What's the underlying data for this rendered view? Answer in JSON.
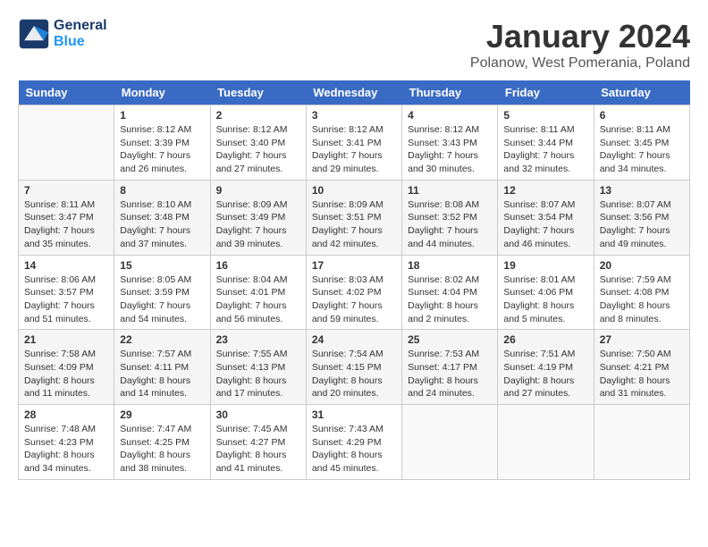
{
  "header": {
    "logo_line1": "General",
    "logo_line2": "Blue",
    "month_title": "January 2024",
    "location": "Polanow, West Pomerania, Poland"
  },
  "weekdays": [
    "Sunday",
    "Monday",
    "Tuesday",
    "Wednesday",
    "Thursday",
    "Friday",
    "Saturday"
  ],
  "weeks": [
    [
      {
        "day": "",
        "info": ""
      },
      {
        "day": "1",
        "info": "Sunrise: 8:12 AM\nSunset: 3:39 PM\nDaylight: 7 hours\nand 26 minutes."
      },
      {
        "day": "2",
        "info": "Sunrise: 8:12 AM\nSunset: 3:40 PM\nDaylight: 7 hours\nand 27 minutes."
      },
      {
        "day": "3",
        "info": "Sunrise: 8:12 AM\nSunset: 3:41 PM\nDaylight: 7 hours\nand 29 minutes."
      },
      {
        "day": "4",
        "info": "Sunrise: 8:12 AM\nSunset: 3:43 PM\nDaylight: 7 hours\nand 30 minutes."
      },
      {
        "day": "5",
        "info": "Sunrise: 8:11 AM\nSunset: 3:44 PM\nDaylight: 7 hours\nand 32 minutes."
      },
      {
        "day": "6",
        "info": "Sunrise: 8:11 AM\nSunset: 3:45 PM\nDaylight: 7 hours\nand 34 minutes."
      }
    ],
    [
      {
        "day": "7",
        "info": ""
      },
      {
        "day": "8",
        "info": "Sunrise: 8:10 AM\nSunset: 3:48 PM\nDaylight: 7 hours\nand 37 minutes."
      },
      {
        "day": "9",
        "info": "Sunrise: 8:09 AM\nSunset: 3:49 PM\nDaylight: 7 hours\nand 39 minutes."
      },
      {
        "day": "10",
        "info": "Sunrise: 8:09 AM\nSunset: 3:51 PM\nDaylight: 7 hours\nand 42 minutes."
      },
      {
        "day": "11",
        "info": "Sunrise: 8:08 AM\nSunset: 3:52 PM\nDaylight: 7 hours\nand 44 minutes."
      },
      {
        "day": "12",
        "info": "Sunrise: 8:07 AM\nSunset: 3:54 PM\nDaylight: 7 hours\nand 46 minutes."
      },
      {
        "day": "13",
        "info": "Sunrise: 8:07 AM\nSunset: 3:56 PM\nDaylight: 7 hours\nand 49 minutes."
      }
    ],
    [
      {
        "day": "14",
        "info": ""
      },
      {
        "day": "15",
        "info": "Sunrise: 8:05 AM\nSunset: 3:59 PM\nDaylight: 7 hours\nand 54 minutes."
      },
      {
        "day": "16",
        "info": "Sunrise: 8:04 AM\nSunset: 4:01 PM\nDaylight: 7 hours\nand 56 minutes."
      },
      {
        "day": "17",
        "info": "Sunrise: 8:03 AM\nSunset: 4:02 PM\nDaylight: 7 hours\nand 59 minutes."
      },
      {
        "day": "18",
        "info": "Sunrise: 8:02 AM\nSunset: 4:04 PM\nDaylight: 8 hours\nand 2 minutes."
      },
      {
        "day": "19",
        "info": "Sunrise: 8:01 AM\nSunset: 4:06 PM\nDaylight: 8 hours\nand 5 minutes."
      },
      {
        "day": "20",
        "info": "Sunrise: 7:59 AM\nSunset: 4:08 PM\nDaylight: 8 hours\nand 8 minutes."
      }
    ],
    [
      {
        "day": "21",
        "info": ""
      },
      {
        "day": "22",
        "info": "Sunrise: 7:57 AM\nSunset: 4:11 PM\nDaylight: 8 hours\nand 14 minutes."
      },
      {
        "day": "23",
        "info": "Sunrise: 7:55 AM\nSunset: 4:13 PM\nDaylight: 8 hours\nand 17 minutes."
      },
      {
        "day": "24",
        "info": "Sunrise: 7:54 AM\nSunset: 4:15 PM\nDaylight: 8 hours\nand 20 minutes."
      },
      {
        "day": "25",
        "info": "Sunrise: 7:53 AM\nSunset: 4:17 PM\nDaylight: 8 hours\nand 24 minutes."
      },
      {
        "day": "26",
        "info": "Sunrise: 7:51 AM\nSunset: 4:19 PM\nDaylight: 8 hours\nand 27 minutes."
      },
      {
        "day": "27",
        "info": "Sunrise: 7:50 AM\nSunset: 4:21 PM\nDaylight: 8 hours\nand 31 minutes."
      }
    ],
    [
      {
        "day": "28",
        "info": ""
      },
      {
        "day": "29",
        "info": "Sunrise: 7:47 AM\nSunset: 4:25 PM\nDaylight: 8 hours\nand 38 minutes."
      },
      {
        "day": "30",
        "info": "Sunrise: 7:45 AM\nSunset: 4:27 PM\nDaylight: 8 hours\nand 41 minutes."
      },
      {
        "day": "31",
        "info": "Sunrise: 7:43 AM\nSunset: 4:29 PM\nDaylight: 8 hours\nand 45 minutes."
      },
      {
        "day": "",
        "info": ""
      },
      {
        "day": "",
        "info": ""
      },
      {
        "day": "",
        "info": ""
      }
    ]
  ],
  "week1_day7_info": "Sunrise: 8:11 AM\nSunset: 3:47 PM\nDaylight: 7 hours\nand 35 minutes.",
  "week2_day1_info": "Sunrise: 8:11 AM\nSunset: 3:47 PM\nDaylight: 7 hours\nand 35 minutes.",
  "week3_day1_info": "Sunrise: 8:06 AM\nSunset: 3:57 PM\nDaylight: 7 hours\nand 51 minutes.",
  "week4_day1_info": "Sunrise: 7:58 AM\nSunset: 4:09 PM\nDaylight: 8 hours\nand 11 minutes.",
  "week5_day1_info": "Sunrise: 7:48 AM\nSunset: 4:23 PM\nDaylight: 8 hours\nand 34 minutes."
}
